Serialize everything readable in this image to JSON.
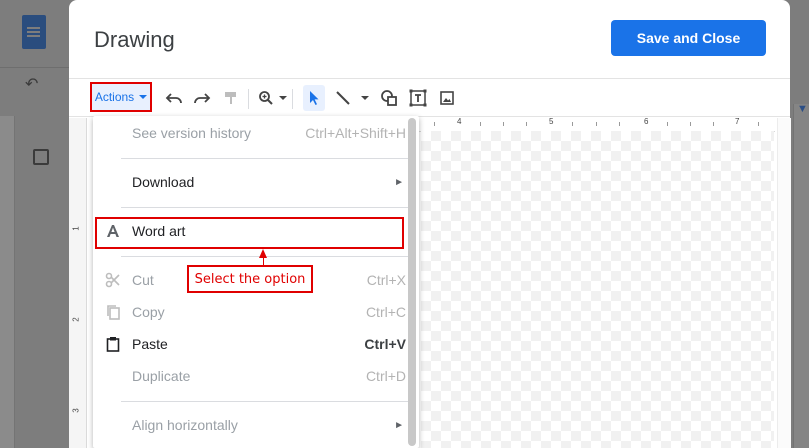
{
  "dialog": {
    "title": "Drawing",
    "save_label": "Save and Close"
  },
  "toolbar": {
    "actions_label": "Actions",
    "icons": [
      "undo-icon",
      "redo-icon",
      "paint-format-icon",
      "zoom-icon",
      "select-icon",
      "line-icon",
      "shape-icon",
      "text-box-icon",
      "image-icon"
    ]
  },
  "ruler": {
    "top_numbers": [
      "4",
      "5",
      "6",
      "7"
    ],
    "left_numbers": [
      "1",
      "2",
      "3"
    ]
  },
  "menu": {
    "items": [
      {
        "label": "See version history",
        "shortcut": "Ctrl+Alt+Shift+H"
      },
      {
        "label": "Download"
      },
      {
        "label": "Word art"
      },
      {
        "label": "Cut",
        "shortcut": "Ctrl+X"
      },
      {
        "label": "Copy",
        "shortcut": "Ctrl+C"
      },
      {
        "label": "Paste",
        "shortcut": "Ctrl+V"
      },
      {
        "label": "Duplicate",
        "shortcut": "Ctrl+D"
      },
      {
        "label": "Align horizontally"
      }
    ]
  },
  "annotation": {
    "text": "Select the option"
  },
  "colors": {
    "accent": "#1a73e8",
    "highlight": "#e00000"
  }
}
